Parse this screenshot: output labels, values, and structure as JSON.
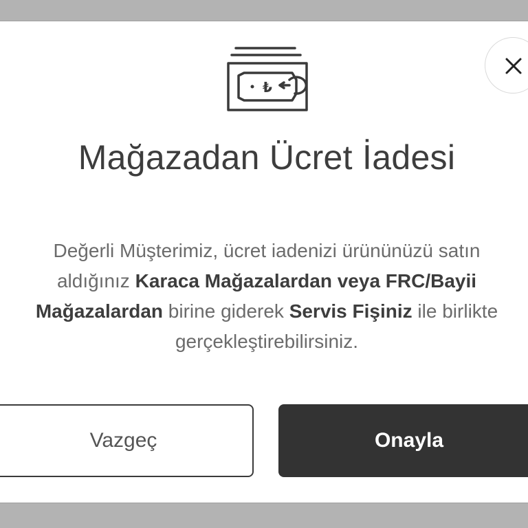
{
  "modal": {
    "title": "Mağazadan Ücret İadesi",
    "icon": "cash-refund-icon",
    "close_icon": "close-icon",
    "message": {
      "line1": "Değerli Müşterimiz, ücret iadenizi ürününüzü satın",
      "line2_prefix": "aldığınız ",
      "line2_bold": "Karaca Mağazalardan veya FRC/Bayii",
      "line3_bold1": "Mağazalardan",
      "line3_middle": " birine giderek ",
      "line3_bold2": "Servis Fişiniz",
      "line3_suffix": " ile birlikte",
      "line4": "gerçekleştirebilirsiniz."
    },
    "buttons": {
      "cancel_label": "Vazgeç",
      "confirm_label": "Onayla"
    }
  },
  "colors": {
    "overlay": "#b3b3b3",
    "confirm_button": "#333333",
    "text_dark": "#3d3d3d",
    "text_muted": "#6b6b6b"
  }
}
